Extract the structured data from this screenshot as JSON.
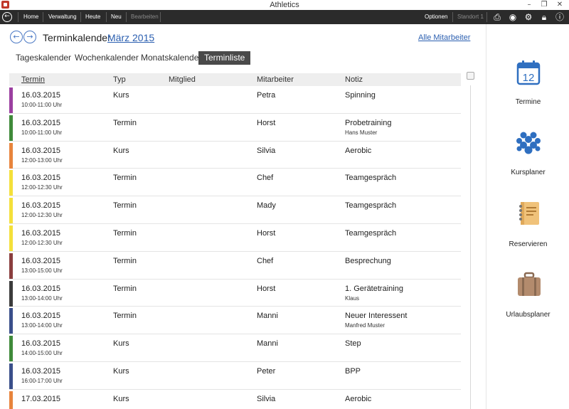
{
  "window": {
    "title": "Athletics",
    "minimize": "–",
    "restore": "❐",
    "close": "✕"
  },
  "menu": {
    "items": [
      "Home",
      "Verwaltung",
      "Heute",
      "Neu",
      "Bearbeiten"
    ],
    "options": "Optionen",
    "location": "Standort 1"
  },
  "header": {
    "title": "Terminkalender",
    "month": "März 2015",
    "all_staff": "Alle Mitarbeiter"
  },
  "tabs": [
    {
      "label": "Tageskalender",
      "active": false
    },
    {
      "label": "Wochenkalender",
      "active": false
    },
    {
      "label": "Monatskalender",
      "active": false
    },
    {
      "label": "Terminliste",
      "active": true
    }
  ],
  "table": {
    "columns": [
      "Termin",
      "Typ",
      "Mitglied",
      "Mitarbeiter",
      "Notiz"
    ],
    "rows": [
      {
        "color": "#9b3fa0",
        "date": "16.03.2015",
        "time": "10:00-11:00 Uhr",
        "type": "Kurs",
        "member": "",
        "staff": "Petra",
        "note": "Spinning",
        "note_sub": ""
      },
      {
        "color": "#3f8a3a",
        "date": "16.03.2015",
        "time": "10:00-11:00 Uhr",
        "type": "Termin",
        "member": "",
        "staff": "Horst",
        "note": "Probetraining",
        "note_sub": "Hans Muster"
      },
      {
        "color": "#e8843c",
        "date": "16.03.2015",
        "time": "12:00-13:00 Uhr",
        "type": "Kurs",
        "member": "",
        "staff": "Silvia",
        "note": "Aerobic",
        "note_sub": ""
      },
      {
        "color": "#f4e03a",
        "date": "16.03.2015",
        "time": "12:00-12:30 Uhr",
        "type": "Termin",
        "member": "",
        "staff": "Chef",
        "note": "Teamgespräch",
        "note_sub": ""
      },
      {
        "color": "#f4e03a",
        "date": "16.03.2015",
        "time": "12:00-12:30 Uhr",
        "type": "Termin",
        "member": "",
        "staff": "Mady",
        "note": "Teamgespräch",
        "note_sub": ""
      },
      {
        "color": "#f4e03a",
        "date": "16.03.2015",
        "time": "12:00-12:30 Uhr",
        "type": "Termin",
        "member": "",
        "staff": "Horst",
        "note": "Teamgespräch",
        "note_sub": ""
      },
      {
        "color": "#8a3e3e",
        "date": "16.03.2015",
        "time": "13:00-15:00 Uhr",
        "type": "Termin",
        "member": "",
        "staff": "Chef",
        "note": "Besprechung",
        "note_sub": ""
      },
      {
        "color": "#3b3b3b",
        "date": "16.03.2015",
        "time": "13:00-14:00 Uhr",
        "type": "Termin",
        "member": "",
        "staff": "Horst",
        "note": "1. Gerätetraining",
        "note_sub": "Klaus"
      },
      {
        "color": "#3a4f8a",
        "date": "16.03.2015",
        "time": "13:00-14:00 Uhr",
        "type": "Termin",
        "member": "",
        "staff": "Manni",
        "note": "Neuer Interessent",
        "note_sub": "Manfred Muster"
      },
      {
        "color": "#3f8a3a",
        "date": "16.03.2015",
        "time": "14:00-15:00 Uhr",
        "type": "Kurs",
        "member": "",
        "staff": "Manni",
        "note": "Step",
        "note_sub": ""
      },
      {
        "color": "#3a4f8a",
        "date": "16.03.2015",
        "time": "16:00-17:00 Uhr",
        "type": "Kurs",
        "member": "",
        "staff": "Peter",
        "note": "BPP",
        "note_sub": ""
      },
      {
        "color": "#e8843c",
        "date": "17.03.2015",
        "time": "",
        "type": "Kurs",
        "member": "",
        "staff": "Silvia",
        "note": "Aerobic",
        "note_sub": ""
      }
    ]
  },
  "sidebar": {
    "items": [
      {
        "label": "Termine",
        "icon": "calendar-icon",
        "icon_text": "12"
      },
      {
        "label": "Kursplaner",
        "icon": "group-icon"
      },
      {
        "label": "Reservieren",
        "icon": "notebook-icon"
      },
      {
        "label": "Urlaubsplaner",
        "icon": "suitcase-icon"
      }
    ]
  },
  "colors": {
    "accent": "#2b5fb0",
    "menubar": "#2b2b2b",
    "active_tab": "#4a4a4a",
    "sidebar_icon": "#2f6fc0"
  }
}
